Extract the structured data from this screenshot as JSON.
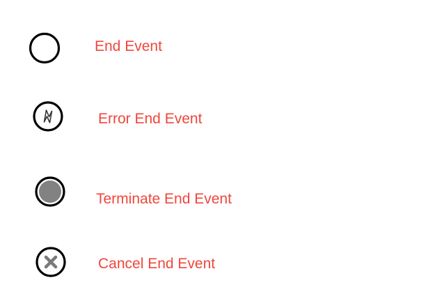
{
  "legend": {
    "label_color": "#f0463c",
    "items": [
      {
        "icon": "end-event-icon",
        "label": "End Event"
      },
      {
        "icon": "error-end-event-icon",
        "label": "Error End Event"
      },
      {
        "icon": "terminate-end-event-icon",
        "label": "Terminate End Event"
      },
      {
        "icon": "cancel-end-event-icon",
        "label": "Cancel End Event"
      }
    ]
  }
}
